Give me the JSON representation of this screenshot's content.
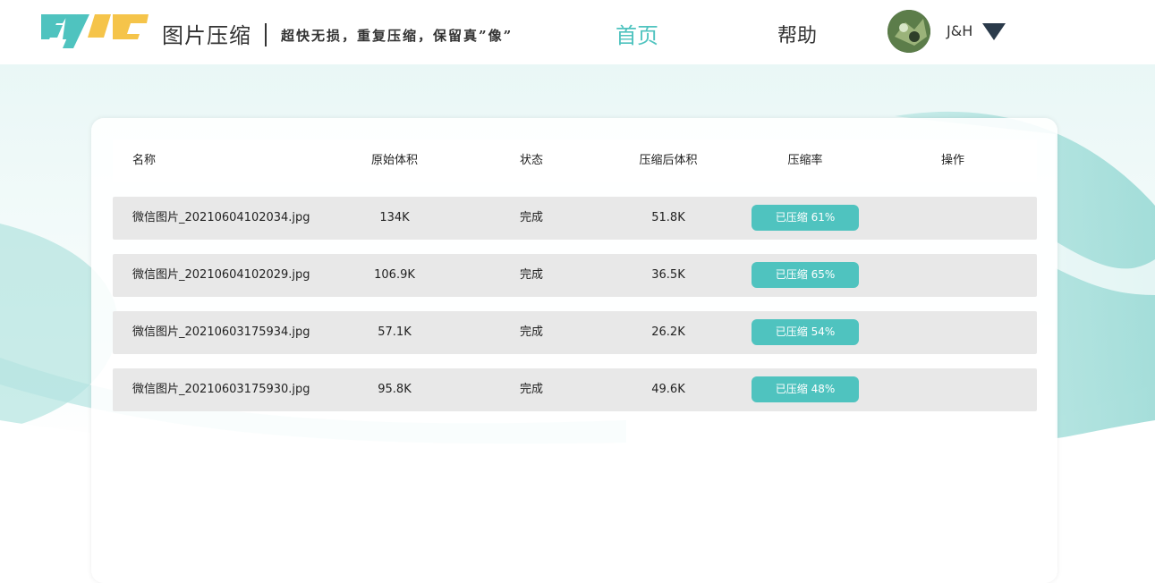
{
  "header": {
    "logo_text": "TJYG",
    "title": "图片压缩",
    "slogan": "超快无损，重复压缩，保留真”像”",
    "nav": {
      "home": "首页",
      "help": "帮助"
    },
    "user": {
      "name": "J&H"
    }
  },
  "colors": {
    "accent": "#4fc3bf",
    "row_bg": "#e8e8e8",
    "text": "#333333"
  },
  "table": {
    "headers": {
      "name": "名称",
      "original_size": "原始体积",
      "status": "状态",
      "compressed_size": "压缩后体积",
      "ratio": "压缩率",
      "actions": "操作"
    },
    "rows": [
      {
        "name": "微信图片_20210604102034.jpg",
        "original_size": "134K",
        "status": "完成",
        "compressed_size": "51.8K",
        "ratio": "已压缩 61%"
      },
      {
        "name": "微信图片_20210604102029.jpg",
        "original_size": "106.9K",
        "status": "完成",
        "compressed_size": "36.5K",
        "ratio": "已压缩 65%"
      },
      {
        "name": "微信图片_20210603175934.jpg",
        "original_size": "57.1K",
        "status": "完成",
        "compressed_size": "26.2K",
        "ratio": "已压缩 54%"
      },
      {
        "name": "微信图片_20210603175930.jpg",
        "original_size": "95.8K",
        "status": "完成",
        "compressed_size": "49.6K",
        "ratio": "已压缩 48%"
      }
    ]
  }
}
